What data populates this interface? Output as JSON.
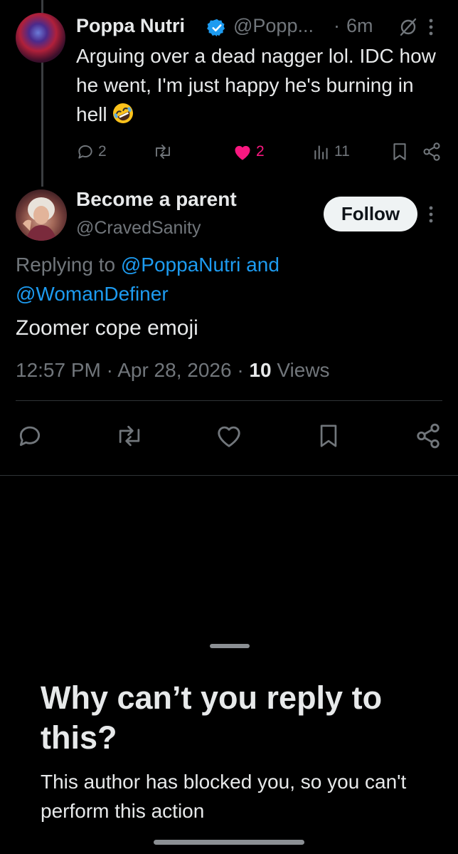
{
  "parent_tweet": {
    "author_name": "Poppa Nutri",
    "author_handle": "@Popp...",
    "separator": "·",
    "time": "6m",
    "text": "Arguing over a dead nagger lol. IDC how he went, I'm just happy he's burning in hell",
    "emoji_icon": "rolling-on-floor-laughing-emoji",
    "replies": "2",
    "reposts": "",
    "likes": "2",
    "views": "11"
  },
  "main_tweet": {
    "author_name": "Become a parent",
    "author_handle": "@CravedSanity",
    "follow_label": "Follow",
    "replying_prefix": "Replying to ",
    "replying_mention_1": "@PoppaNutri",
    "replying_and": " and",
    "replying_mention_2": "@WomanDefiner",
    "text": "Zoomer cope emoji",
    "time": "12:57 PM",
    "separator": " · ",
    "date": "Apr 28, 2026",
    "views_count": "10",
    "views_label": " Views"
  },
  "sheet": {
    "title": "Why can’t you reply to this?",
    "body": "This author has blocked you, so you can't perform this action"
  },
  "colors": {
    "background": "#000000",
    "text_primary": "#e7e9ea",
    "text_secondary": "#71767b",
    "link": "#1d9bf0",
    "like": "#f91880",
    "verified": "#1d9bf0"
  }
}
